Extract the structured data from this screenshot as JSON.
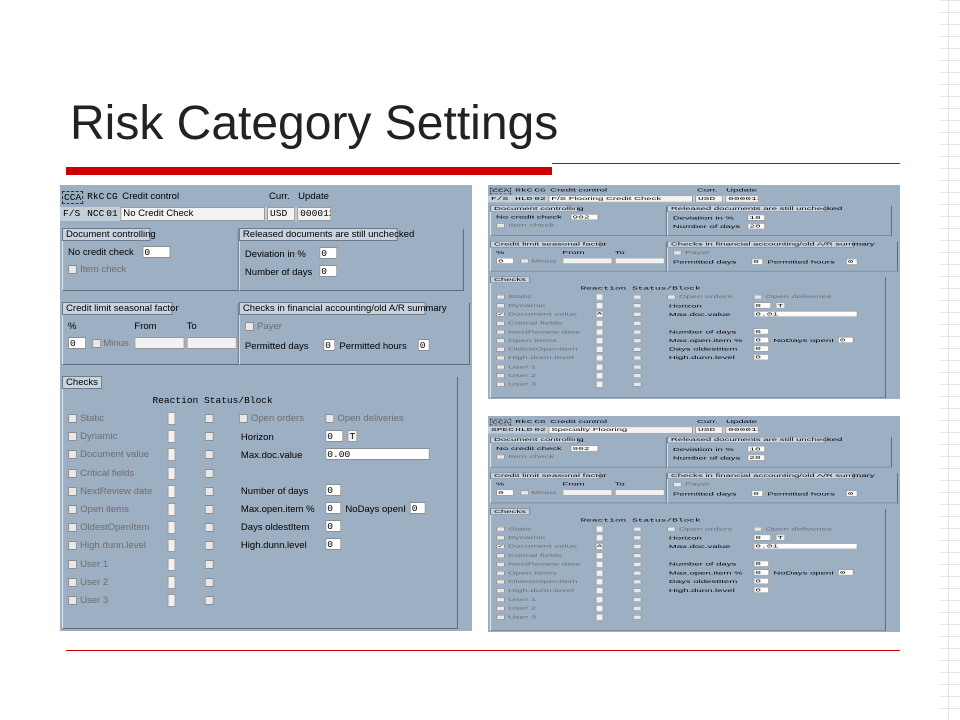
{
  "slide_title": "Risk Category Settings",
  "screens": [
    {
      "cca": "CCA",
      "rkc": "RkC",
      "cg": "CG",
      "title": "Credit control",
      "curr_label": "Curr.",
      "update_label": "Update",
      "cca_val": "F/S",
      "rkc_val": "NCC",
      "cg_val": "01",
      "desc": "No Credit Check",
      "curr": "USD",
      "update": "000012",
      "doc_title": "Document controlling",
      "no_credit_check": "No credit check",
      "no_credit_val": "0",
      "item_check": "Item check",
      "rel_title": "Released documents are still unchecked",
      "dev_label": "Deviation in %",
      "dev_val": "0",
      "days_label": "Number of days",
      "days_val": "0",
      "seas_title": "Credit limit seasonal factor",
      "pct": "%",
      "from": "From",
      "to": "To",
      "pct_val": "0",
      "minus": "Minus",
      "fa_title": "Checks in financial accounting/old A/R summary",
      "payer": "Payer",
      "perm_days": "Permitted days",
      "perm_days_val": "0",
      "perm_hours": "Permitted hours",
      "perm_hours_val": "0",
      "checks_title": "Checks",
      "rsb": "Reaction Status/Block",
      "checks": [
        "Static",
        "Dynamic",
        "Document value",
        "Critical fields",
        "NextReview date",
        "Open items",
        "OldestOpenItem",
        "High.dunn.level",
        "User 1",
        "User 2",
        "User 3"
      ],
      "check_marks": [
        "",
        "",
        "",
        "",
        "",
        "",
        "",
        "",
        "",
        "",
        ""
      ],
      "open_orders": "Open orders",
      "open_deliveries": "Open deliveries",
      "horizon": "Horizon",
      "horizon_val": "0",
      "horizon_unit": "T",
      "maxdoc": "Max.doc.value",
      "maxdoc_val": "0.00",
      "numdays": "Number of days",
      "numdays_val": "0",
      "maxopen": "Max.open.item %",
      "maxopen_val": "0",
      "nodays": "NoDays openI",
      "nodays_val": "0",
      "oldest": "Days oldestItem",
      "oldest_val": "0",
      "highdunn": "High.dunn.level",
      "highdunn_val": "0"
    },
    {
      "cca": "CCA",
      "rkc": "RkC",
      "cg": "CG",
      "title": "Credit control",
      "curr_label": "Curr.",
      "update_label": "Update",
      "cca_val": "F/S",
      "rkc_val": "HLD",
      "cg_val": "02",
      "desc": "F/S Flooring Credit Check",
      "curr": "USD",
      "update": "000012",
      "doc_title": "Document controlling",
      "no_credit_check": "No credit check",
      "no_credit_val": "902",
      "item_check": "Item check",
      "rel_title": "Released documents are still unchecked",
      "dev_label": "Deviation in %",
      "dev_val": "10",
      "days_label": "Number of days",
      "days_val": "20",
      "seas_title": "Credit limit seasonal factor",
      "pct": "%",
      "from": "From",
      "to": "To",
      "pct_val": "0",
      "minus": "Minus",
      "fa_title": "Checks in financial accounting/old A/R summary",
      "payer": "Payer",
      "perm_days": "Permitted days",
      "perm_days_val": "0",
      "perm_hours": "Permitted hours",
      "perm_hours_val": "0",
      "checks_title": "Checks",
      "rsb": "Reaction Status/Block",
      "checks": [
        "Static",
        "Dynamic",
        "Document value",
        "Critical fields",
        "NextReview date",
        "Open items",
        "OldestOpenItem",
        "High.dunn.level",
        "User 1",
        "User 2",
        "User 3"
      ],
      "check_marks": [
        "",
        "",
        "✓",
        "",
        "",
        "",
        "",
        "",
        "",
        "",
        ""
      ],
      "reaction_vals": [
        "",
        "",
        "A",
        "",
        "",
        "",
        "",
        "",
        "",
        "",
        ""
      ],
      "open_orders": "Open orders",
      "open_deliveries": "Open deliveries",
      "horizon": "Horizon",
      "horizon_val": "0",
      "horizon_unit": "T",
      "maxdoc": "Max.doc.value",
      "maxdoc_val": "0.01",
      "numdays": "Number of days",
      "numdays_val": "0",
      "maxopen": "Max.open.item %",
      "maxopen_val": "0",
      "nodays": "NoDays openI",
      "nodays_val": "0",
      "oldest": "Days oldestItem",
      "oldest_val": "0",
      "highdunn": "High.dunn.level",
      "highdunn_val": "0"
    },
    {
      "cca": "CCA",
      "rkc": "RkC",
      "cg": "CG",
      "title": "Credit control",
      "curr_label": "Curr.",
      "update_label": "Update",
      "cca_val": "SPEC",
      "rkc_val": "HLD",
      "cg_val": "02",
      "desc": "Specialty Flooring",
      "curr": "USD",
      "update": "000012",
      "doc_title": "Document controlling",
      "no_credit_check": "No credit check",
      "no_credit_val": "902",
      "item_check": "Item check",
      "rel_title": "Released documents are still unchecked",
      "dev_label": "Deviation in %",
      "dev_val": "10",
      "days_label": "Number of days",
      "days_val": "20",
      "seas_title": "Credit limit seasonal factor",
      "pct": "%",
      "from": "From",
      "to": "To",
      "pct_val": "0",
      "minus": "Minus",
      "fa_title": "Checks in financial accounting/old A/R summary",
      "payer": "Payer",
      "perm_days": "Permitted days",
      "perm_days_val": "0",
      "perm_hours": "Permitted hours",
      "perm_hours_val": "0",
      "checks_title": "Checks",
      "rsb": "Reaction Status/Block",
      "checks": [
        "Static",
        "Dynamic",
        "Document value",
        "Critical fields",
        "NextReview date",
        "Open items",
        "OldestOpenItem",
        "High.dunn.level",
        "User 1",
        "User 2",
        "User 3"
      ],
      "check_marks": [
        "",
        "",
        "✓",
        "",
        "",
        "",
        "",
        "",
        "",
        "",
        ""
      ],
      "reaction_vals": [
        "",
        "",
        "A",
        "",
        "",
        "",
        "",
        "",
        "",
        "",
        ""
      ],
      "open_orders": "Open orders",
      "open_deliveries": "Open deliveries",
      "horizon": "Horizon",
      "horizon_val": "0",
      "horizon_unit": "T",
      "maxdoc": "Max.doc.value",
      "maxdoc_val": "0.01",
      "numdays": "Number of days",
      "numdays_val": "0",
      "maxopen": "Max.open.item %",
      "maxopen_val": "0",
      "nodays": "NoDays openI",
      "nodays_val": "0",
      "oldest": "Days oldestItem",
      "oldest_val": "0",
      "highdunn": "High.dunn.level",
      "highdunn_val": "0"
    }
  ]
}
